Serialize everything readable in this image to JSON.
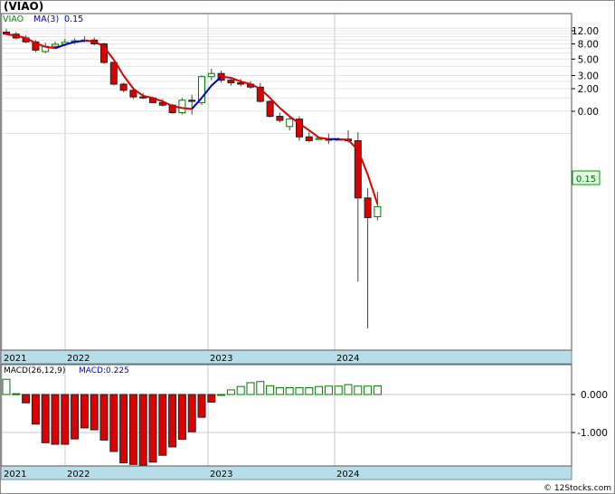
{
  "header": {
    "title": "(VIAO)"
  },
  "price_panel": {
    "symbol": "VIAO",
    "ma_label": "MA(3)",
    "ma_value": "0.15",
    "last_price_tag": "0.15"
  },
  "macd_panel": {
    "label": "MACD(26,12,9)",
    "macd_value_label": "MACD:0.225"
  },
  "footer": {
    "watermark": "© 12Stocks.com"
  },
  "colors": {
    "up": "#007a00",
    "down": "#dd0000",
    "ma_up": "#0000cc",
    "ma_down": "#dd0000",
    "axis_band": "#b7dde8",
    "grid": "#c8c8c8",
    "tag_bg": "#e0ffe0",
    "tag_border": "#009900"
  },
  "chart_data": [
    {
      "type": "candlestick",
      "scale": "log",
      "yticks": [
        "12.00",
        "8.00",
        "5.00",
        "3.00",
        "2.00",
        "0.00"
      ],
      "x_tick_labels": [
        "2021",
        "2022",
        "2023",
        "2024"
      ],
      "series": [
        {
          "date": "2021-01",
          "open": 11.5,
          "high": 12.8,
          "low": 10.5,
          "close": 10.8
        },
        {
          "date": "2021-02",
          "open": 10.8,
          "high": 11.5,
          "low": 9.2,
          "close": 9.6
        },
        {
          "date": "2021-03",
          "open": 9.6,
          "high": 10.4,
          "low": 8.2,
          "close": 8.5
        },
        {
          "date": "2021-04",
          "open": 8.5,
          "high": 9.0,
          "low": 6.2,
          "close": 6.6
        },
        {
          "date": "2021-05",
          "open": 6.3,
          "high": 8.3,
          "low": 6.0,
          "close": 7.4
        },
        {
          "date": "2021-06",
          "open": 7.4,
          "high": 8.6,
          "low": 6.9,
          "close": 7.9
        },
        {
          "date": "2021-07",
          "open": 7.9,
          "high": 9.3,
          "low": 7.5,
          "close": 8.4
        },
        {
          "date": "2021-08",
          "open": 8.4,
          "high": 9.5,
          "low": 7.9,
          "close": 8.8
        },
        {
          "date": "2021-09",
          "open": 8.8,
          "high": 10.2,
          "low": 8.4,
          "close": 9.0
        },
        {
          "date": "2021-10",
          "open": 9.0,
          "high": 9.7,
          "low": 7.6,
          "close": 8.0
        },
        {
          "date": "2021-11",
          "open": 8.0,
          "high": 8.3,
          "low": 4.3,
          "close": 4.5
        },
        {
          "date": "2021-12",
          "open": 4.5,
          "high": 4.6,
          "low": 2.2,
          "close": 2.3
        },
        {
          "date": "2022-01",
          "open": 2.3,
          "high": 2.4,
          "low": 1.8,
          "close": 1.9
        },
        {
          "date": "2022-02",
          "open": 1.9,
          "high": 2.1,
          "low": 1.45,
          "close": 1.55
        },
        {
          "date": "2022-03",
          "open": 1.55,
          "high": 1.75,
          "low": 1.45,
          "close": 1.5
        },
        {
          "date": "2022-04",
          "open": 1.5,
          "high": 1.55,
          "low": 1.28,
          "close": 1.3
        },
        {
          "date": "2022-05",
          "open": 1.3,
          "high": 1.45,
          "low": 1.15,
          "close": 1.2
        },
        {
          "date": "2022-06",
          "open": 1.2,
          "high": 1.25,
          "low": 0.92,
          "close": 0.95
        },
        {
          "date": "2022-07",
          "open": 0.95,
          "high": 1.5,
          "low": 0.9,
          "close": 1.4
        },
        {
          "date": "2022-08",
          "open": 1.4,
          "high": 1.65,
          "low": 0.9,
          "close": 1.35
        },
        {
          "date": "2022-09",
          "open": 1.3,
          "high": 3.0,
          "low": 1.2,
          "close": 2.9
        },
        {
          "date": "2022-10",
          "open": 2.9,
          "high": 3.7,
          "low": 2.6,
          "close": 3.2
        },
        {
          "date": "2022-11",
          "open": 3.2,
          "high": 3.5,
          "low": 2.4,
          "close": 2.6
        },
        {
          "date": "2022-12",
          "open": 2.6,
          "high": 2.8,
          "low": 2.2,
          "close": 2.4
        },
        {
          "date": "2023-01",
          "open": 2.4,
          "high": 2.7,
          "low": 2.15,
          "close": 2.3
        },
        {
          "date": "2023-02",
          "open": 2.3,
          "high": 2.5,
          "low": 2.0,
          "close": 2.1
        },
        {
          "date": "2023-03",
          "open": 2.1,
          "high": 2.4,
          "low": 1.3,
          "close": 1.35
        },
        {
          "date": "2023-04",
          "open": 1.35,
          "high": 1.4,
          "low": 0.82,
          "close": 0.85
        },
        {
          "date": "2023-05",
          "open": 0.85,
          "high": 0.95,
          "low": 0.7,
          "close": 0.75
        },
        {
          "date": "2023-06",
          "open": 0.62,
          "high": 0.85,
          "low": 0.55,
          "close": 0.78
        },
        {
          "date": "2023-07",
          "open": 0.78,
          "high": 0.85,
          "low": 0.4,
          "close": 0.45
        },
        {
          "date": "2023-08",
          "open": 0.45,
          "high": 0.52,
          "low": 0.38,
          "close": 0.4
        },
        {
          "date": "2023-09",
          "open": 0.42,
          "high": 0.44,
          "low": 0.42,
          "close": 0.43
        },
        {
          "date": "2023-10",
          "open": 0.42,
          "high": 0.5,
          "low": 0.36,
          "close": 0.41
        },
        {
          "date": "2023-11",
          "open": 0.41,
          "high": 0.44,
          "low": 0.4,
          "close": 0.42
        },
        {
          "date": "2023-12",
          "open": 0.42,
          "high": 0.55,
          "low": 0.38,
          "close": 0.4
        },
        {
          "date": "2024-01",
          "open": 0.4,
          "high": 0.52,
          "low": 0.0051,
          "close": 0.068
        },
        {
          "date": "2024-02",
          "open": 0.068,
          "high": 0.092,
          "low": 0.0012,
          "close": 0.037
        },
        {
          "date": "2024-03",
          "open": 0.038,
          "high": 0.082,
          "low": 0.034,
          "close": 0.052
        }
      ],
      "ma": [
        10.8,
        10.3,
        9.6,
        8.2,
        7.3,
        7.0,
        7.8,
        8.5,
        8.8,
        8.7,
        7.3,
        4.9,
        3.0,
        2.0,
        1.6,
        1.5,
        1.35,
        1.17,
        1.1,
        1.07,
        1.5,
        2.2,
        2.9,
        2.8,
        2.5,
        2.3,
        2.0,
        1.5,
        1.1,
        0.85,
        0.68,
        0.55,
        0.44,
        0.42,
        0.42,
        0.41,
        0.3,
        0.14,
        0.056
      ]
    },
    {
      "type": "bar",
      "title": "MACD(26,12,9)",
      "yticks": [
        "0.000",
        "-1.000"
      ],
      "x_tick_labels": [
        "2021",
        "2022",
        "2023",
        "2024"
      ],
      "values": [
        0.4,
        0.02,
        -0.22,
        -0.78,
        -1.27,
        -1.31,
        -1.31,
        -1.17,
        -0.88,
        -0.93,
        -1.2,
        -1.5,
        -1.8,
        -1.84,
        -1.86,
        -1.78,
        -1.6,
        -1.38,
        -1.18,
        -0.98,
        -0.6,
        -0.2,
        0.0,
        0.12,
        0.21,
        0.31,
        0.34,
        0.23,
        0.18,
        0.18,
        0.18,
        0.18,
        0.21,
        0.22,
        0.22,
        0.26,
        0.22,
        0.22,
        0.225
      ]
    }
  ]
}
